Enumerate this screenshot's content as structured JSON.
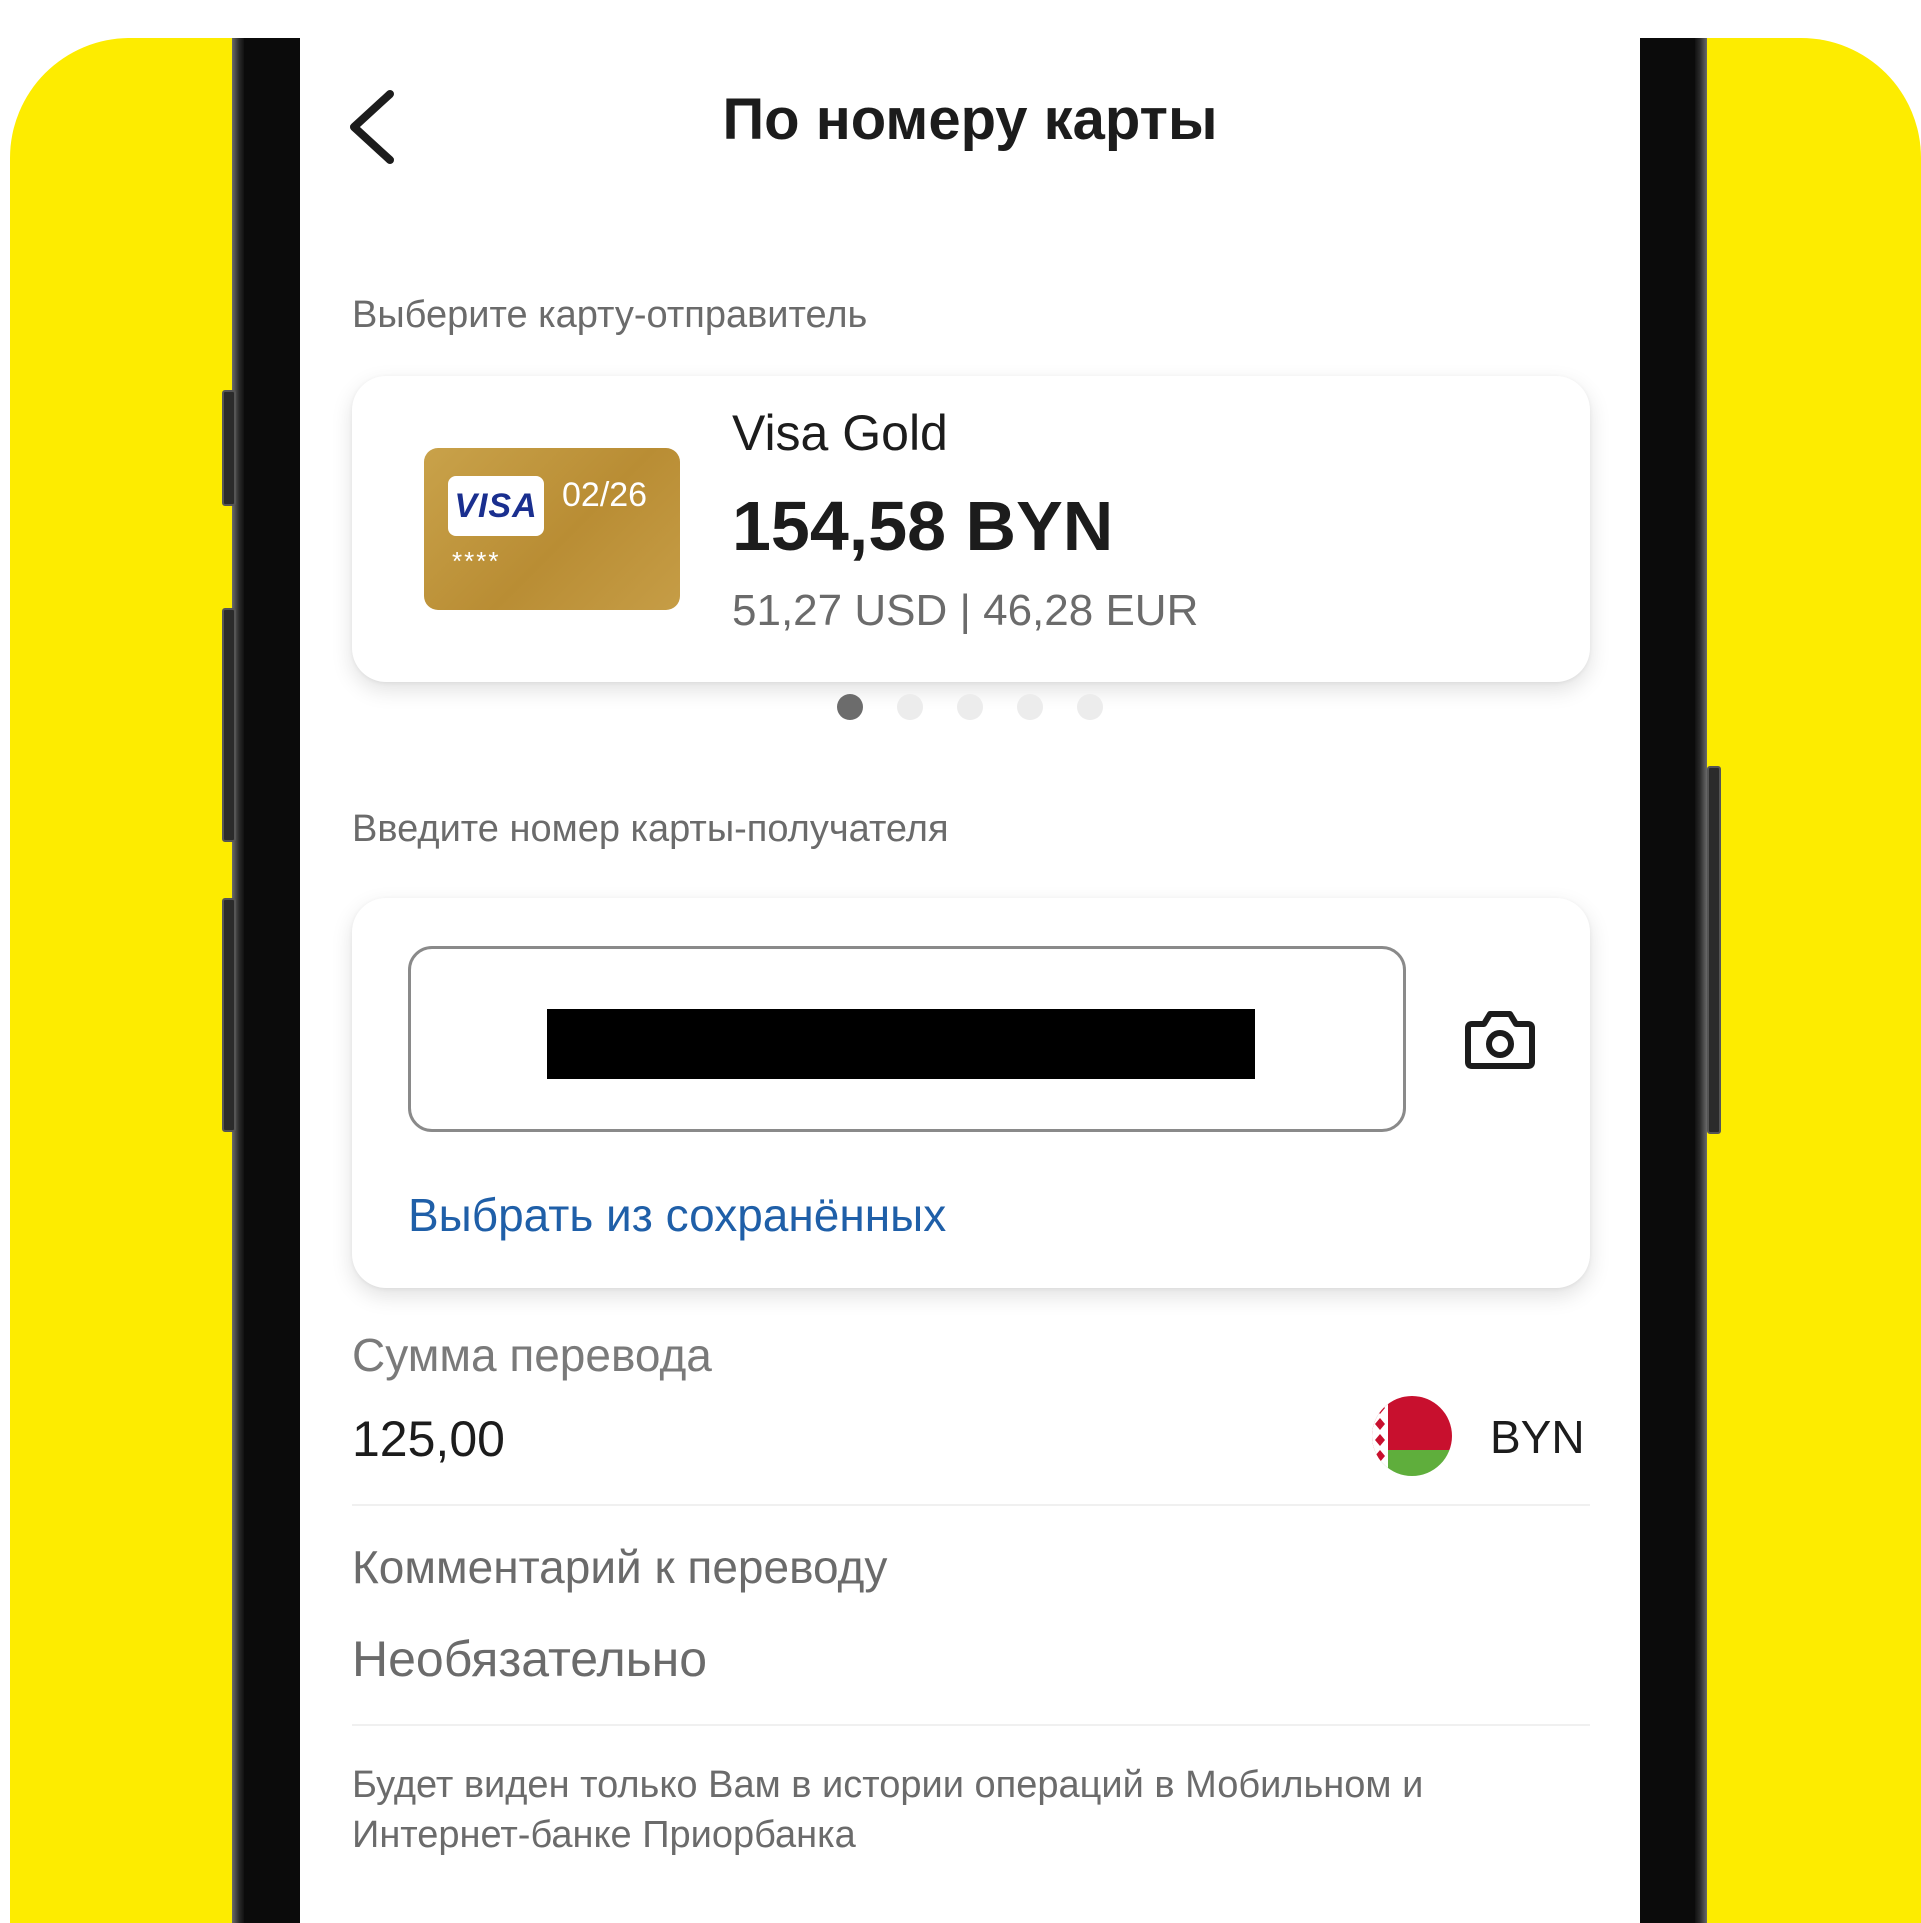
{
  "header": {
    "title": "По номеру карты",
    "back_icon": "chevron-left-icon"
  },
  "sender": {
    "label": "Выберите карту-отправитель",
    "card": {
      "brand": "VISA",
      "expiry": "02/26",
      "masked_number": "****",
      "name": "Visa Gold",
      "balance": "154,58 BYN",
      "secondary_balances": "51,27 USD | 46,28 EUR",
      "card_color": "#c9a24a"
    },
    "pagination": {
      "total": 5,
      "active_index": 0
    }
  },
  "recipient": {
    "label": "Введите номер карты-получателя",
    "camera_icon": "camera-icon",
    "saved_link": "Выбрать из сохранённых"
  },
  "amount": {
    "label": "Сумма перевода",
    "value": "125,00",
    "currency": "BYN",
    "flag_icon": "belarus-flag-icon"
  },
  "comment": {
    "label": "Комментарий к переводу",
    "placeholder": "Необязательно",
    "hint": "Будет виден только Вам в истории операций в Мобильном и Интернет-банке Приорбанка"
  },
  "colors": {
    "background_accent": "#fdec00",
    "link": "#1f5fa8",
    "text_primary": "#1c1c1c",
    "text_secondary": "#6b6b6b"
  }
}
